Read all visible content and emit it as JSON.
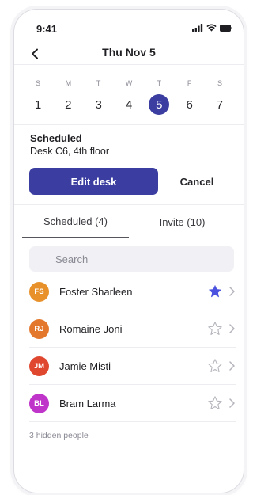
{
  "status": {
    "time": "9:41"
  },
  "header": {
    "title": "Thu Nov 5"
  },
  "week": [
    {
      "dow": "S",
      "num": "1"
    },
    {
      "dow": "M",
      "num": "2"
    },
    {
      "dow": "T",
      "num": "3"
    },
    {
      "dow": "W",
      "num": "4"
    },
    {
      "dow": "T",
      "num": "5",
      "selected": true
    },
    {
      "dow": "F",
      "num": "6"
    },
    {
      "dow": "S",
      "num": "7"
    }
  ],
  "schedule": {
    "title": "Scheduled",
    "subtitle": "Desk C6, 4th floor"
  },
  "actions": {
    "edit_label": "Edit desk",
    "cancel_label": "Cancel"
  },
  "tabs": [
    {
      "label": "Scheduled (4)",
      "active": true
    },
    {
      "label": "Invite (10)",
      "active": false
    }
  ],
  "search": {
    "placeholder": "Search"
  },
  "people": [
    {
      "initials": "FS",
      "name": "Foster Sharleen",
      "color": "#e8912b",
      "starred": true
    },
    {
      "initials": "RJ",
      "name": "Romaine Joni",
      "color": "#e3782c",
      "starred": false
    },
    {
      "initials": "JM",
      "name": "Jamie Misti",
      "color": "#e0472f",
      "starred": false
    },
    {
      "initials": "BL",
      "name": "Bram Larma",
      "color": "#bf35c9",
      "starred": false
    }
  ],
  "footer_note": "3 hidden people",
  "colors": {
    "accent": "#3b3ea0",
    "star_active": "#4b52e0"
  }
}
